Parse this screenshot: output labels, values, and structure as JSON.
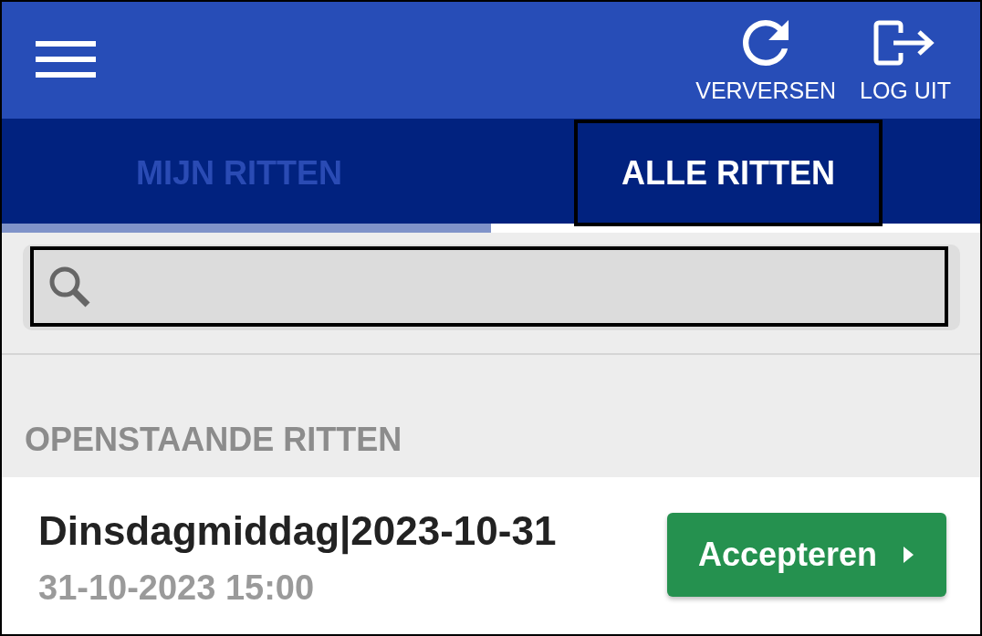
{
  "header": {
    "actions": [
      {
        "kind": "refresh",
        "label": "VERVERSEN"
      },
      {
        "kind": "logout",
        "label": "LOG UIT"
      }
    ]
  },
  "tabs": [
    {
      "label": "MIJN RITTEN",
      "selected": false,
      "underlined": true
    },
    {
      "label": "ALLE RITTEN",
      "selected": true,
      "underlined": false
    }
  ],
  "search": {
    "focused": true
  },
  "section": {
    "title": "OPENSTAANDE RITTEN",
    "rides": [
      {
        "title": "Dinsdagmiddag|2023-10-31",
        "datetime": "31-10-2023 15:00",
        "action": "Accepteren"
      }
    ]
  }
}
